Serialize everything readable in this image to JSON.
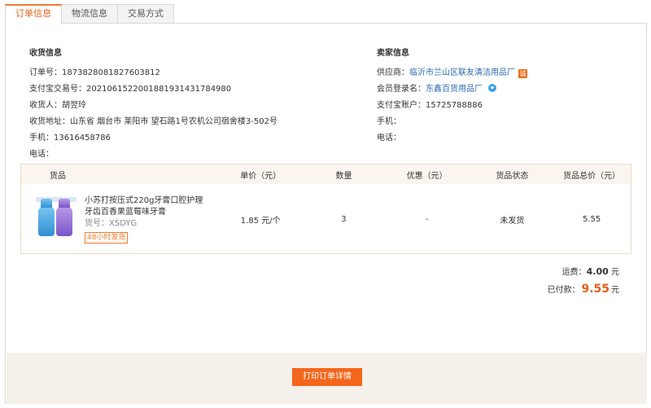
{
  "tabs": [
    {
      "label": "订单信息",
      "active": true
    },
    {
      "label": "物流信息",
      "active": false
    },
    {
      "label": "交易方式",
      "active": false
    }
  ],
  "receiver": {
    "title": "收货信息",
    "rows": [
      {
        "label": "订单号：",
        "value": "1873828081827603812"
      },
      {
        "label": "支付宝交易号：",
        "value": "2021061522001881931431784980"
      },
      {
        "label": "收货人：",
        "value": "胡翌玲"
      },
      {
        "label": "收货地址：",
        "value": "山东省 烟台市 莱阳市 望石路1号农机公司宿舍楼3-502号"
      },
      {
        "label": "手机：",
        "value": "13616458786"
      },
      {
        "label": "电话：",
        "value": ""
      }
    ]
  },
  "seller": {
    "title": "卖家信息",
    "supplier_label": "供应商：",
    "supplier_value": "临沂市兰山区联友清洁用品厂",
    "supplier_badge": "诚",
    "member_label": "会员登录名：",
    "member_value": "东鑫百货用品厂",
    "alipay_label": "支付宝账户：",
    "alipay_value": "15725788886",
    "mobile_label": "手机：",
    "mobile_value": "",
    "phone_label": "电话：",
    "phone_value": ""
  },
  "table": {
    "headers": [
      "货品",
      "单价（元）",
      "数量",
      "优惠（元）",
      "货品状态",
      "货品总价（元）"
    ],
    "rows": [
      {
        "name": "小苏打按压式220g牙膏口腔护理牙齿百香果蓝莓味牙膏",
        "code": "货号：XSDYG",
        "tag": "48小时发货",
        "price": "1.85 元/个",
        "qty": "3",
        "discount": "-",
        "status": "未发货",
        "total": "5.55"
      }
    ]
  },
  "totals": {
    "shipping_label": "运费：",
    "shipping_value": "4.00",
    "shipping_unit": "元",
    "paid_label": "已付款：",
    "paid_value": "9.55",
    "paid_unit": "元"
  },
  "footer": {
    "print_button": "打印订单详情"
  },
  "colors": {
    "accent": "#f3661c",
    "link": "#2b6bb3"
  }
}
